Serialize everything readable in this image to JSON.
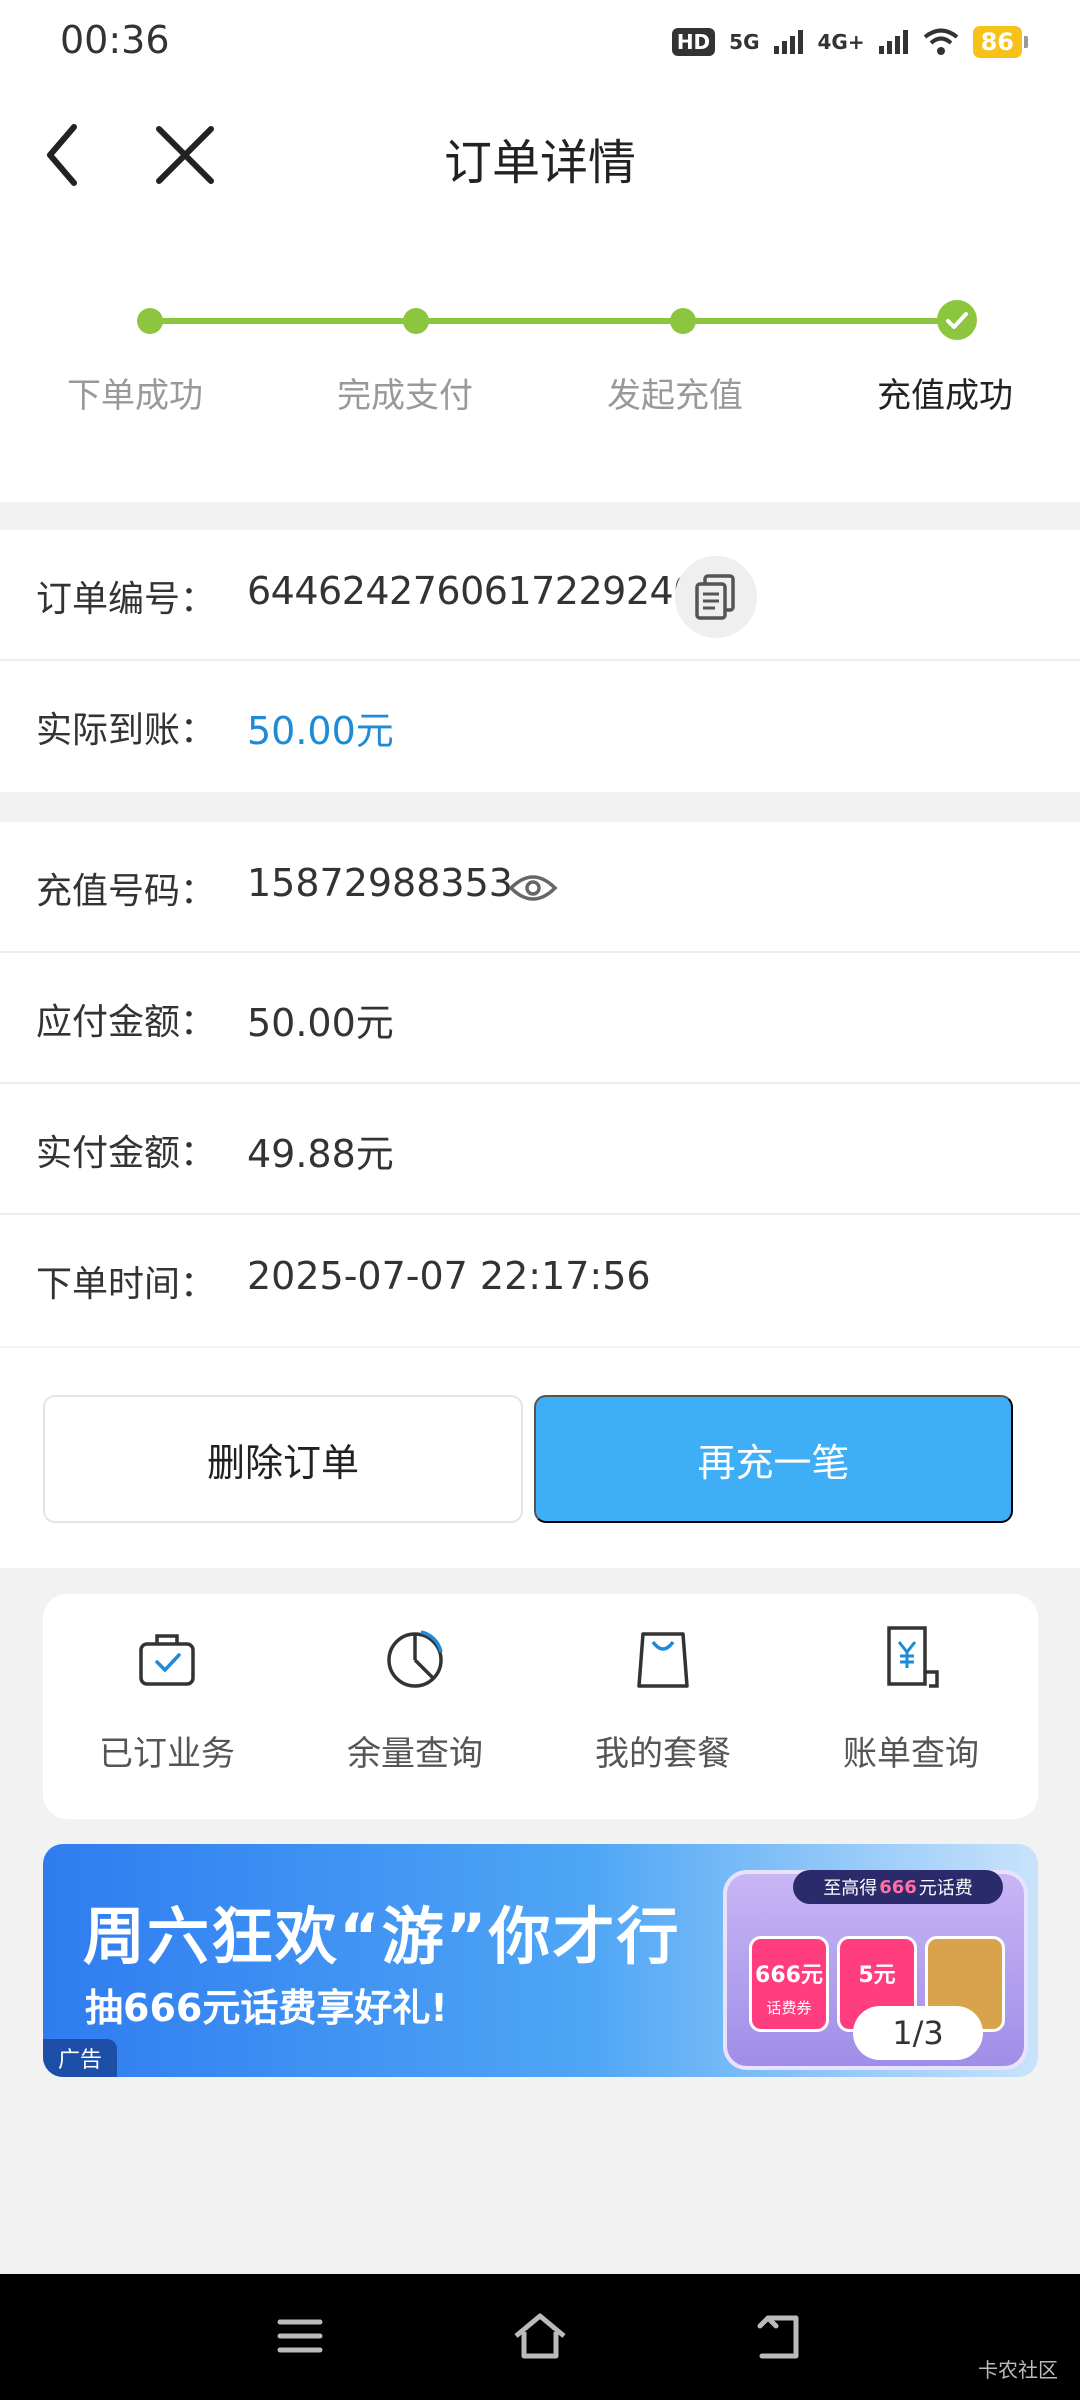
{
  "status_bar": {
    "time": "00:36",
    "hd_label": "HD",
    "signal_1": "5G",
    "signal_2": "4G+",
    "battery": "86"
  },
  "header": {
    "title": "订单详情"
  },
  "progress": {
    "steps": [
      {
        "label": "下单成功"
      },
      {
        "label": "完成支付"
      },
      {
        "label": "发起充值"
      },
      {
        "label": "充值成功"
      }
    ],
    "active_color": "#8cc63f"
  },
  "order_info": {
    "order_no_label": "订单编号：",
    "order_no": "6446242760617229240",
    "received_label": "实际到账：",
    "received": "50.00元"
  },
  "recharge_info": {
    "phone_label": "充值号码：",
    "phone": "15872988353",
    "payable_label": "应付金额：",
    "payable": "50.00元",
    "paid_label": "实付金额：",
    "paid": "49.88元",
    "time_label": "下单时间：",
    "time": "2025-07-07 22:17:56"
  },
  "actions": {
    "delete_label": "删除订单",
    "recharge_label": "再充一笔",
    "primary_color": "#3eaef6"
  },
  "quick_links": [
    {
      "label": "已订业务",
      "icon": "briefcase-check-icon"
    },
    {
      "label": "余量查询",
      "icon": "pie-chart-icon"
    },
    {
      "label": "我的套餐",
      "icon": "shopping-bag-icon"
    },
    {
      "label": "账单查询",
      "icon": "bill-yuan-icon"
    }
  ],
  "banner": {
    "title": "周六狂欢“游”你才行",
    "subtitle": "抽666元话费享好礼!",
    "ad_label": "广告",
    "chip_pre": "至高得",
    "chip_num": "666",
    "chip_post": "元话费",
    "card1": "666元",
    "card1_sub": "话费券",
    "card2": "5元",
    "pager": "1/3"
  },
  "watermark": "卡农社区"
}
